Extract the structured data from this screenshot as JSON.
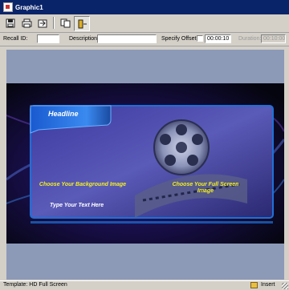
{
  "window": {
    "title": "Graphic1"
  },
  "toolbar": {
    "buttons": [
      {
        "name": "save-icon"
      },
      {
        "name": "print-icon"
      },
      {
        "name": "export-icon"
      },
      {
        "name": "duplicate-icon"
      },
      {
        "name": "layout-icon"
      }
    ]
  },
  "fields": {
    "recall_label": "Recall ID:",
    "recall_value": "",
    "description_label": "Description:",
    "description_value": "",
    "offset_label": "Specify Offset:",
    "offset_value": "00:00:10",
    "duration_label": "Duration:",
    "duration_value": "00:10:00"
  },
  "preview": {
    "headline": "Headline",
    "background_hint": "Choose Your Background Image",
    "fullscreen_hint": "Choose Your Full Screen Image",
    "text_hint": "Type Your Text Here"
  },
  "status": {
    "template": "Template: HD Full Screen",
    "mode": "Insert"
  },
  "colors": {
    "accent_blue": "#1e70d8",
    "hint_yellow": "#f4f020",
    "title_bar": "#0a246a"
  }
}
